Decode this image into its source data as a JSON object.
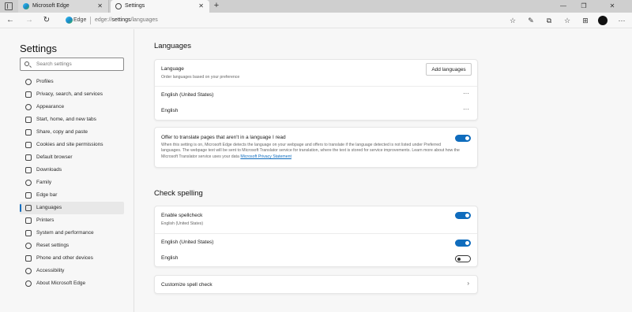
{
  "browser": {
    "tabs": [
      {
        "title": "Microsoft Edge",
        "active": false
      },
      {
        "title": "Settings",
        "active": true
      }
    ],
    "close_glyph": "✕",
    "new_tab_glyph": "+",
    "window_controls": {
      "minimize": "—",
      "restore": "❐",
      "close": "✕"
    },
    "address": {
      "site_label": "Edge",
      "url_prefix": "edge://",
      "url_path": "settings",
      "url_suffix": "/languages"
    },
    "accent_color": "#0f6cbd"
  },
  "sidebar": {
    "title": "Settings",
    "search_placeholder": "Search settings",
    "items": [
      {
        "label": "Profiles",
        "icon": "profile-icon"
      },
      {
        "label": "Privacy, search, and services",
        "icon": "lock-icon"
      },
      {
        "label": "Appearance",
        "icon": "appearance-icon"
      },
      {
        "label": "Start, home, and new tabs",
        "icon": "home-icon"
      },
      {
        "label": "Share, copy and paste",
        "icon": "share-icon"
      },
      {
        "label": "Cookies and site permissions",
        "icon": "cookie-icon"
      },
      {
        "label": "Default browser",
        "icon": "browser-icon"
      },
      {
        "label": "Downloads",
        "icon": "download-icon"
      },
      {
        "label": "Family",
        "icon": "family-icon"
      },
      {
        "label": "Edge bar",
        "icon": "edge-bar-icon"
      },
      {
        "label": "Languages",
        "icon": "languages-icon",
        "selected": true
      },
      {
        "label": "Printers",
        "icon": "printer-icon"
      },
      {
        "label": "System and performance",
        "icon": "system-icon"
      },
      {
        "label": "Reset settings",
        "icon": "reset-icon"
      },
      {
        "label": "Phone and other devices",
        "icon": "phone-icon"
      },
      {
        "label": "Accessibility",
        "icon": "accessibility-icon"
      },
      {
        "label": "About Microsoft Edge",
        "icon": "edge-logo-icon"
      }
    ]
  },
  "languages": {
    "heading": "Languages",
    "language_title": "Language",
    "language_subtitle": "Order languages based on your preference",
    "add_button": "Add languages",
    "list": [
      "English (United States)",
      "English"
    ],
    "more_glyph": "···",
    "translate_title": "Offer to translate pages that aren't in a language I read",
    "translate_enabled": true,
    "translate_desc": "When this setting is on, Microsoft Edge detects the language on your webpage and offers to translate if the language detected is not listed under Preferred languages. The webpage text will be sent to Microsoft Translator service for translation, where the text is stored for service improvements. Learn more about how the Microsoft Translator service uses your data ",
    "privacy_link": "Microsoft Privacy Statement"
  },
  "spelling": {
    "heading": "Check spelling",
    "enable_title": "Enable spellcheck",
    "enable_subtitle": "English (United States)",
    "enable_on": true,
    "languages": [
      {
        "label": "English (United States)",
        "enabled": true
      },
      {
        "label": "English",
        "enabled": false
      }
    ],
    "customize_label": "Customize spell check",
    "chevron_glyph": "›"
  }
}
